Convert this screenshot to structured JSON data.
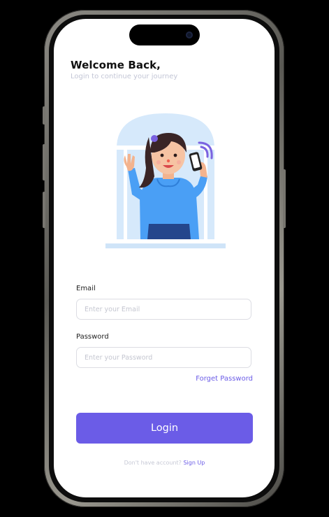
{
  "header": {
    "title": "Welcome Back,",
    "subtitle": "Login to continue your journey"
  },
  "form": {
    "email_label": "Email",
    "email_placeholder": "Enter your Email",
    "email_value": "",
    "password_label": "Password",
    "password_placeholder": "Enter your Password",
    "password_value": "",
    "forget_password": "Forget Password",
    "login_button": "Login"
  },
  "footer": {
    "no_account_text": "Don't have account?",
    "signup_link": "Sign Up"
  },
  "colors": {
    "accent": "#6b5ce7",
    "window_bg": "#d6e9fb",
    "shirt": "#4a9ff5",
    "background": "#000000"
  },
  "icons": {
    "illustration": "woman-waving-with-phone"
  }
}
